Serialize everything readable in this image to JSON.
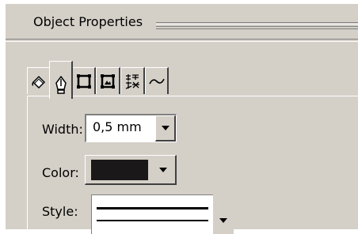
{
  "panel": {
    "title": "Object Properties"
  },
  "tabs": [
    {
      "id": "fill",
      "icon": "fill-bucket-icon",
      "active": false
    },
    {
      "id": "outline",
      "icon": "pen-nib-icon",
      "active": true
    },
    {
      "id": "frame",
      "icon": "frame-square-icon",
      "active": false
    },
    {
      "id": "frame-image",
      "icon": "frame-image-icon",
      "active": false
    },
    {
      "id": "effects",
      "icon": "sparkle-shape-icon",
      "active": false
    },
    {
      "id": "curve",
      "icon": "tilde-curve-icon",
      "active": false
    }
  ],
  "outline": {
    "width_label": "Width:",
    "width_value": "0,5 mm",
    "color_label": "Color:",
    "color_value": "#1a1818",
    "style_label": "Style:"
  }
}
